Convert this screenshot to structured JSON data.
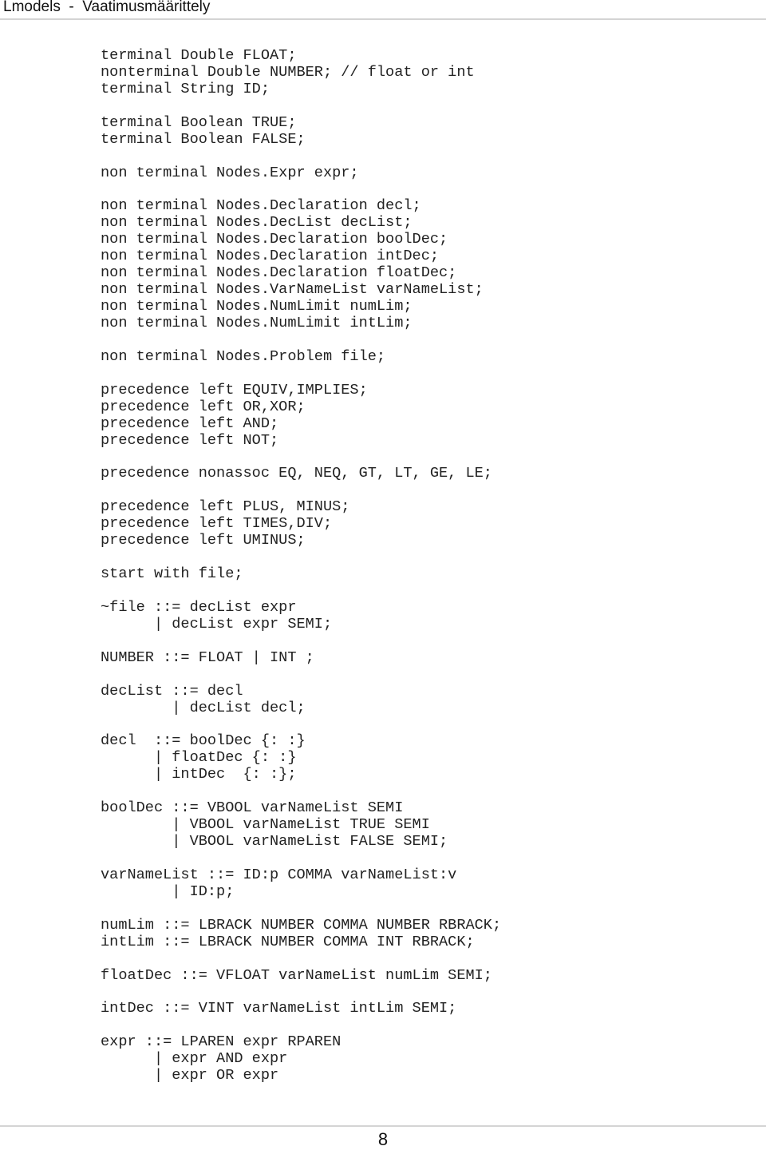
{
  "header": {
    "title": "Lmodels  -  Vaatimusmäärittely"
  },
  "code": {
    "lines": [
      "terminal Double FLOAT;",
      "nonterminal Double NUMBER; // float or int",
      "terminal String ID;",
      "",
      "terminal Boolean TRUE;",
      "terminal Boolean FALSE;",
      "",
      "non terminal Nodes.Expr expr;",
      "",
      "non terminal Nodes.Declaration decl;",
      "non terminal Nodes.DecList decList;",
      "non terminal Nodes.Declaration boolDec;",
      "non terminal Nodes.Declaration intDec;",
      "non terminal Nodes.Declaration floatDec;",
      "non terminal Nodes.VarNameList varNameList;",
      "non terminal Nodes.NumLimit numLim;",
      "non terminal Nodes.NumLimit intLim;",
      "",
      "non terminal Nodes.Problem file;",
      "",
      "precedence left EQUIV,IMPLIES;",
      "precedence left OR,XOR;",
      "precedence left AND;",
      "precedence left NOT;",
      "",
      "precedence nonassoc EQ, NEQ, GT, LT, GE, LE;",
      "",
      "precedence left PLUS, MINUS;",
      "precedence left TIMES,DIV;",
      "precedence left UMINUS;",
      "",
      "start with file;",
      "",
      "~file ::= decList expr",
      "      | decList expr SEMI;",
      "",
      "NUMBER ::= FLOAT | INT ;",
      "",
      "decList ::= decl",
      "        | decList decl;",
      "",
      "decl  ::= boolDec {: :}",
      "      | floatDec {: :}",
      "      | intDec  {: :};",
      "",
      "boolDec ::= VBOOL varNameList SEMI",
      "        | VBOOL varNameList TRUE SEMI",
      "        | VBOOL varNameList FALSE SEMI;",
      "",
      "varNameList ::= ID:p COMMA varNameList:v",
      "        | ID:p;",
      "",
      "numLim ::= LBRACK NUMBER COMMA NUMBER RBRACK;",
      "intLim ::= LBRACK NUMBER COMMA INT RBRACK;",
      "",
      "floatDec ::= VFLOAT varNameList numLim SEMI;",
      "",
      "intDec ::= VINT varNameList intLim SEMI;",
      "",
      "expr ::= LPAREN expr RPAREN",
      "      | expr AND expr",
      "      | expr OR expr"
    ]
  },
  "footer": {
    "page_number": "8"
  }
}
